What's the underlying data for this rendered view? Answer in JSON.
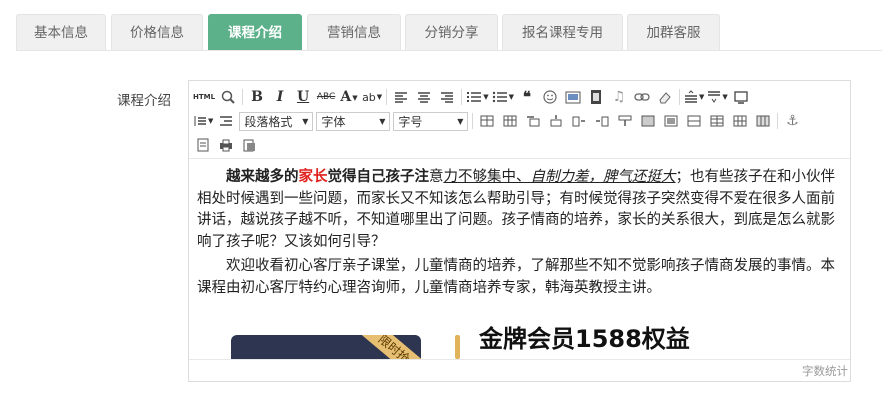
{
  "tabs": [
    {
      "label": "基本信息",
      "active": false
    },
    {
      "label": "价格信息",
      "active": false
    },
    {
      "label": "课程介绍",
      "active": true
    },
    {
      "label": "营销信息",
      "active": false
    },
    {
      "label": "分销分享",
      "active": false
    },
    {
      "label": "报名课程专用",
      "active": false
    },
    {
      "label": "加群客服",
      "active": false
    }
  ],
  "field_label": "课程介绍",
  "toolbar": {
    "html_label": "HTML",
    "bold": "B",
    "italic": "I",
    "underline": "U",
    "strike": "ABC",
    "fontcolor": "A",
    "backcolor": "ab",
    "quote": "66",
    "paragraph_select": "段落格式",
    "font_select": "字体",
    "size_select": "字号"
  },
  "content": {
    "p1_bold_a": "越来越多的",
    "p1_bold_red": "家长",
    "p1_bold_b": "觉得自己孩子注",
    "p1_c": "意",
    "p1_ul": "力不够集中、",
    "p1_ul_it": "自制力差，脾气还挺大",
    "p1_rest": "；也有些孩子在和小伙伴相处时候遇到一些问题，而家长又不知该怎么帮助引导；有时候觉得孩子突然变得不爱在很多人面前讲话，越说孩子越不听，不知道哪里出了问题。孩子情商的培养，家长的关系很大，到底是怎么就影响了孩子呢？又该如何引导？",
    "p2": "欢迎收看初心客厅亲子课堂，儿童情商的培养，了解那些不知不觉影响孩子情商发展的事情。本课程由初心客厅特约心理咨询师，儿童情商培养专家，韩海英教授主讲。",
    "ribbon": "限时抢",
    "promo_title": "金牌会员1588权益"
  },
  "statusbar": {
    "wordcount": "字数统计"
  },
  "colors": {
    "tab_active": "#5cb08a",
    "highlight_red": "#e0201b",
    "promo_bar": "#e0b35a"
  }
}
